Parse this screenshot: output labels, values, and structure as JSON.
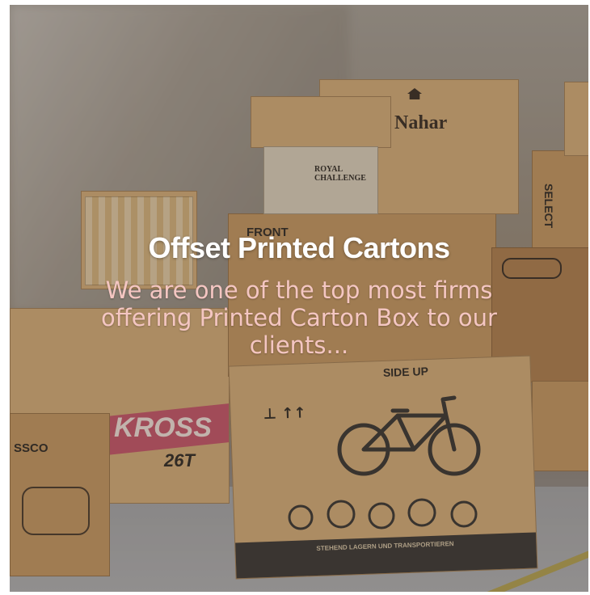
{
  "hero": {
    "title": "Offset Printed Cartons",
    "description": "We are one of the top most firms offering  Printed Carton Box to our clients..."
  },
  "scene": {
    "box_labels": {
      "nahar": "Nahar",
      "front": "FRONT",
      "kross": "KROSS",
      "select": "SELECT",
      "royal": "ROYAL CHALLENGE",
      "sscor": "SSCO",
      "side_up": "SIDE UP",
      "bike_size": "26T",
      "transport": "STEHEND LAGERN UND TRANSPORTIEREN"
    }
  },
  "colors": {
    "title": "#ffffff",
    "description": "#f4c6c2",
    "carton": "#c89a63",
    "overlay": "rgba(58,48,40,0.28)"
  }
}
